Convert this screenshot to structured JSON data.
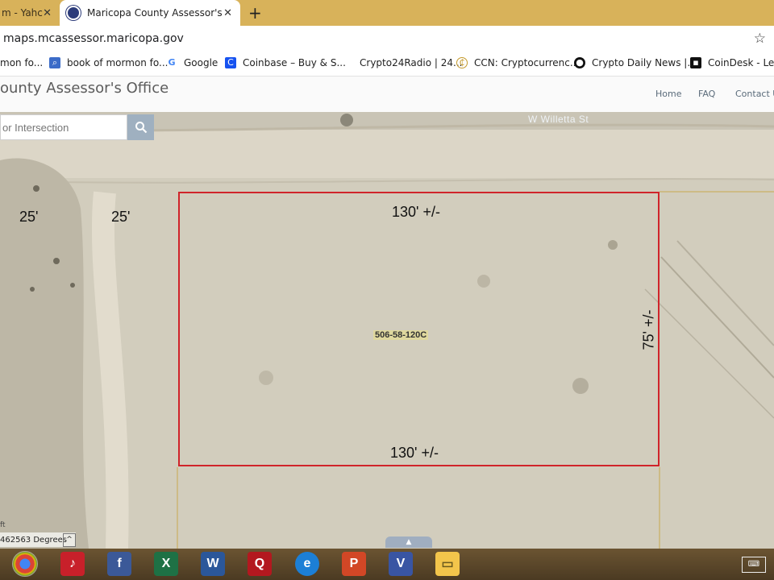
{
  "tabs": [
    {
      "label": "m - Yahc",
      "active": false
    },
    {
      "label": "Maricopa County Assessor's Offic",
      "active": true
    }
  ],
  "address": "maps.mcassessor.maricopa.gov",
  "bookmarks": [
    {
      "label": "mon fo..."
    },
    {
      "label": "book of mormon fo..."
    },
    {
      "label": "Google"
    },
    {
      "label": "Coinbase – Buy & S..."
    },
    {
      "label": "Crypto24Radio | 24..."
    },
    {
      "label": "CCN: Cryptocurrenc..."
    },
    {
      "label": "Crypto Daily News |..."
    },
    {
      "label": "CoinDesk - Lead"
    }
  ],
  "site": {
    "title": "ounty Assessor's Office",
    "nav": [
      "Home",
      "FAQ",
      "Contact U"
    ]
  },
  "map": {
    "search_placeholder": "or Intersection",
    "street": "W Willetta St",
    "dims": {
      "left_a": "25'",
      "left_b": "25'",
      "top": "130' +/-",
      "bottom": "130' +/-",
      "right": "75' +/-"
    },
    "parcel_id": "506-58-120C",
    "coord_readout": "462563 Degrees",
    "ft_label": "ft"
  },
  "colors": {
    "lot_outline": "#d0242a",
    "tabbar": "#d8b25a",
    "search_button": "#9fb0c0"
  },
  "taskbar_icons": [
    "chrome-icon",
    "itunes-icon",
    "facebook-icon",
    "excel-icon",
    "word-icon",
    "quicken-icon",
    "ie-icon",
    "powerpoint-icon",
    "visio-icon",
    "file-explorer-icon",
    "keyboard-icon"
  ]
}
